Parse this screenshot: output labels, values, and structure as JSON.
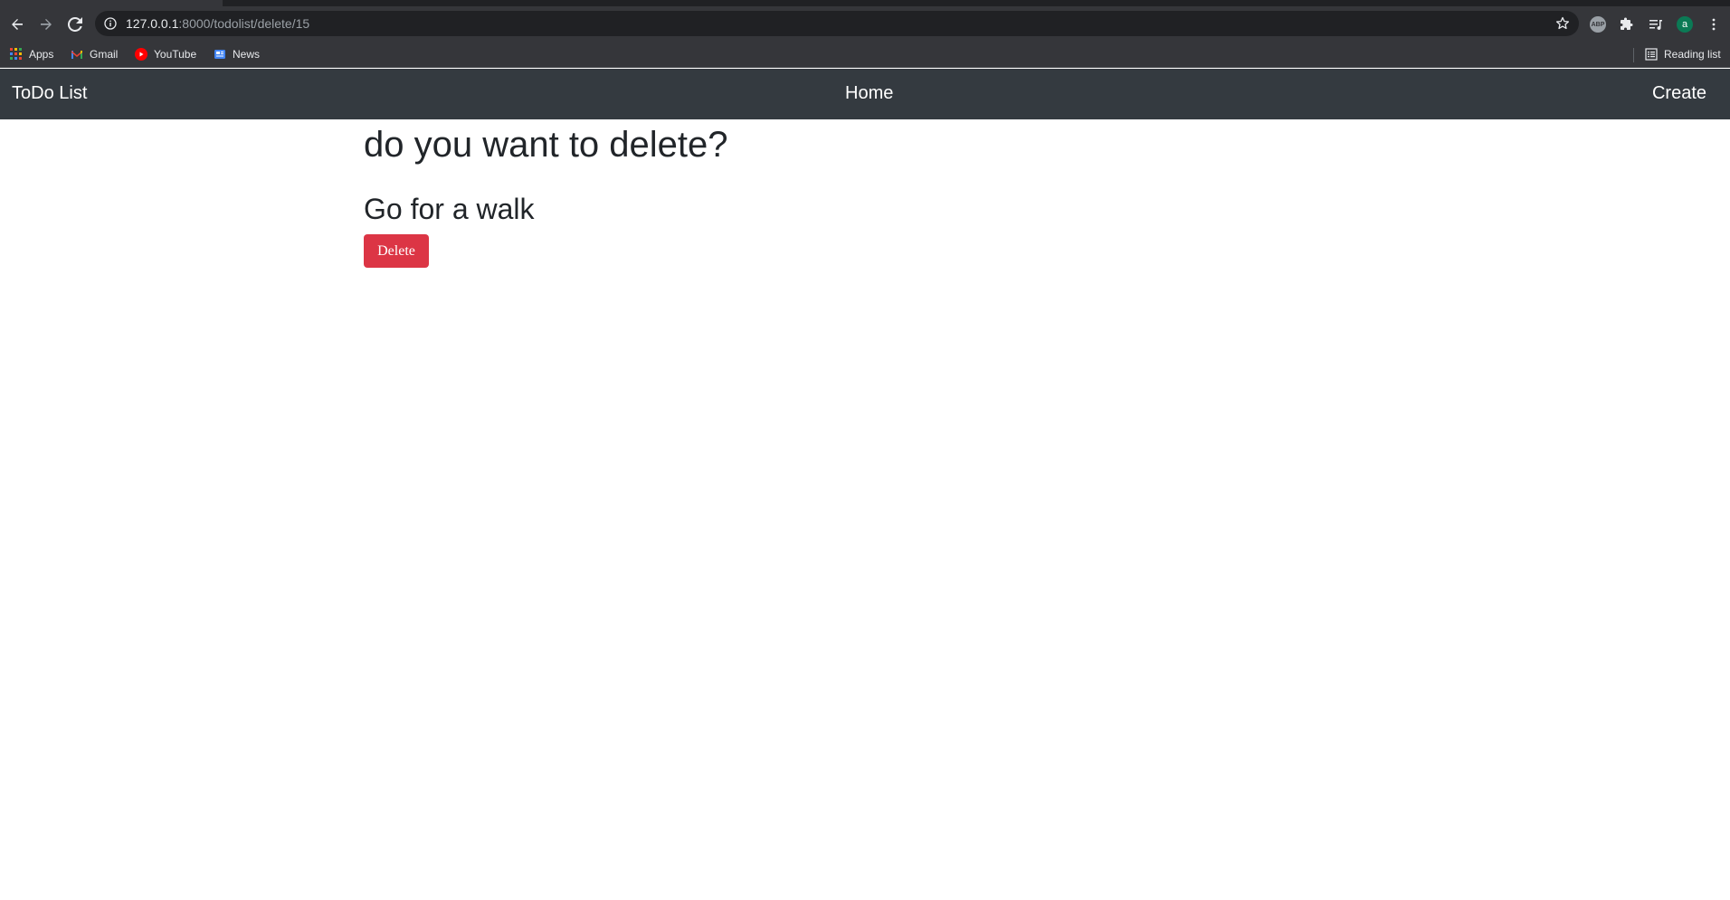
{
  "browser": {
    "url_host": "127.0.0.1",
    "url_rest": ":8000/todolist/delete/15",
    "profile_initial": "a",
    "abp_label": "ABP",
    "bookmarks": [
      {
        "label": "Apps",
        "icon": "apps-grid-icon"
      },
      {
        "label": "Gmail",
        "icon": "gmail-icon"
      },
      {
        "label": "YouTube",
        "icon": "youtube-icon"
      },
      {
        "label": "News",
        "icon": "news-icon"
      }
    ],
    "reading_list_label": "Reading list"
  },
  "navbar": {
    "brand": "ToDo List",
    "home_label": "Home",
    "create_label": "Create"
  },
  "main": {
    "heading": "do you want to delete?",
    "item_title": "Go for a walk",
    "delete_label": "Delete"
  },
  "colors": {
    "navbar_bg": "#343a40",
    "danger": "#dc3545",
    "chrome_bg": "#35363a",
    "text": "#212529"
  }
}
